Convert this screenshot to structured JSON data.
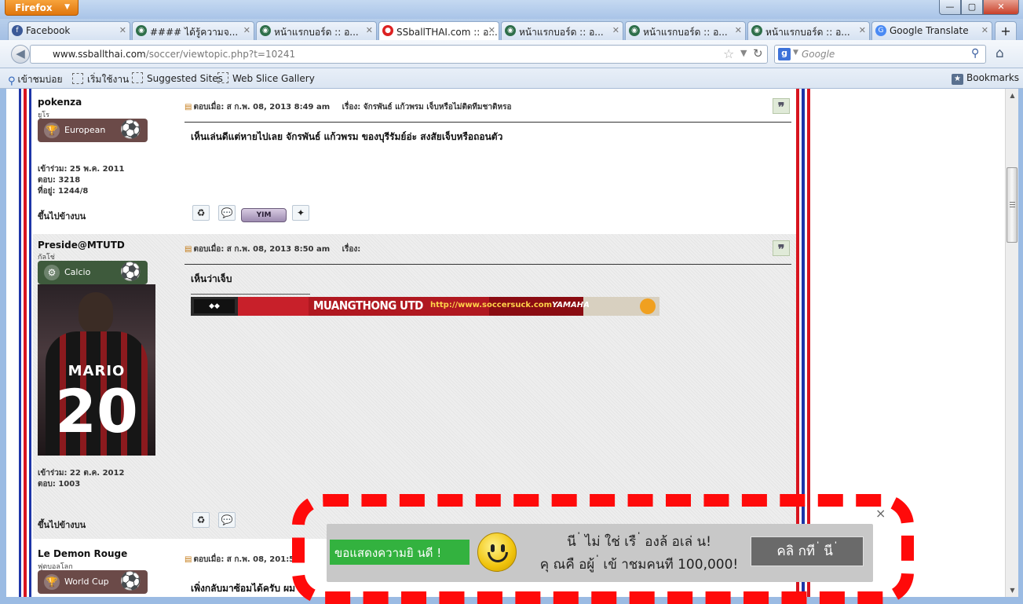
{
  "browser": {
    "menu_button": "Firefox",
    "window_buttons": {
      "minimize": "—",
      "maximize": "▢",
      "close": "✕"
    },
    "tabs": [
      {
        "label": "Facebook",
        "favicon": "f",
        "favicon_color": "#3b5998"
      },
      {
        "label": "#### ได้รู้ความจ...",
        "favicon": "◉",
        "favicon_color": "#2f6f4a"
      },
      {
        "label": "หน้าแรกบอร์ด :: อ...",
        "favicon": "◉",
        "favicon_color": "#2f6f4a"
      },
      {
        "label": "SSballTHAI.com :: อ...",
        "favicon": "●",
        "favicon_color": "#d22",
        "active": true
      },
      {
        "label": "หน้าแรกบอร์ด :: อ...",
        "favicon": "◉",
        "favicon_color": "#2f6f4a"
      },
      {
        "label": "หน้าแรกบอร์ด :: อ...",
        "favicon": "◉",
        "favicon_color": "#2f6f4a"
      },
      {
        "label": "หน้าแรกบอร์ด :: อ...",
        "favicon": "◉",
        "favicon_color": "#2f6f4a"
      },
      {
        "label": "Google Translate",
        "favicon": "G",
        "favicon_color": "#4a8af4"
      }
    ],
    "new_tab": "+",
    "url_domain": "www.ssballthai.com",
    "url_path": "/soccer/viewtopic.php?t=10241",
    "search_placeholder": "Google",
    "bookmarks": [
      {
        "label": "เข้าชมบ่อย"
      },
      {
        "label": "เริ่มใช้งาน"
      },
      {
        "label": "Suggested Sites"
      },
      {
        "label": "Web Slice Gallery"
      }
    ],
    "bookmarks_menu": "Bookmarks"
  },
  "posts": [
    {
      "username": "pokenza",
      "rank_title": "ยูโร",
      "rank_badge": "European",
      "rank_color": "#6b4a48",
      "joined": "เข้าร่วม: 25 พ.ค. 2011",
      "replies": "ตอบ: 3218",
      "location": "ที่อยู่: 1244/8",
      "back_to_top": "ขึ้นไปข้างบน",
      "posted": "ตอบเมื่อ: ส ก.พ. 08, 2013 8:49 am",
      "subject": "เรื่อง: จักรพันธ์ แก้วพรม เจ็บหรือไม่ติดทีมชาติหรอ",
      "text": "เห็นเล่นดีแต่หายไปเลย จักรพันธ์ แก้วพรม ของบุรีรัมย์อ่ะ สงสัยเจ็บหรือถอนตัว",
      "yim_label": "YIM"
    },
    {
      "username": "Preside@MTUTD",
      "rank_title": "กัลโช่",
      "rank_badge": "Calcio",
      "rank_color": "#3e5a3c",
      "joined": "เข้าร่วม: 22 ต.ค. 2012",
      "replies": "ตอบ: 1003",
      "back_to_top": "ขึ้นไปข้างบน",
      "posted": "ตอบเมื่อ: ส ก.พ. 08, 2013 8:50 am",
      "subject": "เรื่อง:",
      "text": "เห็นว่าเจ็บ",
      "avatar_name": "MARIO",
      "avatar_number": "20",
      "signature": {
        "title": "MUANGTHONG UTD",
        "url": "http://www.soccersuck.com",
        "sponsor": "YAMAHA"
      }
    },
    {
      "username": "Le Demon Rouge",
      "rank_title": "ฟุตบอลโลก",
      "rank_badge": "World Cup",
      "rank_color": "#6b4a48",
      "posted": "ตอบเมื่อ: ส ก.พ. 08, 201",
      "posted_suffix": ":53",
      "text": "เพิ่งกลับมาซ้อมได้ครับ ผม"
    }
  ],
  "ad": {
    "tag": "ขอแสดงความยิ  นดี  !",
    "line1": "นี  ่  ไม่  ใช่  เรื  ่ องล้  อเล่  น!",
    "line2": "คุ  ณคื  อผู้  ่ เข้  าชมคนที  100,000!",
    "cta": "คลิ  กที  ่  นี  ่",
    "close": "×"
  }
}
